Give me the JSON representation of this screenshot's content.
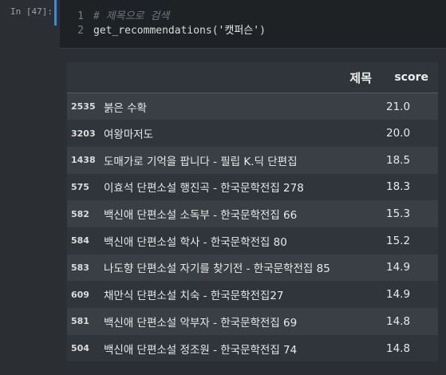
{
  "cell": {
    "prompt": "In [47]:",
    "line_numbers": [
      "1",
      "2"
    ],
    "comment": "# 제목으로 검색",
    "code_fn": "get_recommendations(",
    "code_arg": "'캣퍼슨'",
    "code_close": ")"
  },
  "table": {
    "headers": {
      "index": "",
      "title": "제목",
      "score": "score"
    },
    "rows": [
      {
        "index": "2535",
        "title": "붉은 수확",
        "score": "21.0"
      },
      {
        "index": "3203",
        "title": "여왕마저도",
        "score": "20.0"
      },
      {
        "index": "1438",
        "title": "도매가로 기억을 팝니다 - 필립 K.딕 단편집",
        "score": "18.5"
      },
      {
        "index": "575",
        "title": "이효석 단편소설 행진곡 - 한국문학전집 278",
        "score": "18.3"
      },
      {
        "index": "582",
        "title": "백신애 단편소설 소독부 - 한국문학전집 66",
        "score": "15.3"
      },
      {
        "index": "584",
        "title": "백신애 단편소설 학사 - 한국문학전집 80",
        "score": "15.2"
      },
      {
        "index": "583",
        "title": "나도향 단편소설 자기를 찾기전 - 한국문학전집 85",
        "score": "14.9"
      },
      {
        "index": "609",
        "title": "채만식 단편소설 치숙 - 한국문학전집27",
        "score": "14.9"
      },
      {
        "index": "581",
        "title": "백신애 단편소설 악부자 - 한국문학전집 69",
        "score": "14.8"
      },
      {
        "index": "504",
        "title": "백신애 단편소설 정조원 - 한국문학전집 74",
        "score": "14.8"
      }
    ]
  },
  "colors": {
    "background": "#2b2f34",
    "editor_bg": "#1f2225",
    "cell_selected_bar": "#3f8bd6",
    "row_odd": "#3a3f45",
    "row_even": "#30353b"
  }
}
